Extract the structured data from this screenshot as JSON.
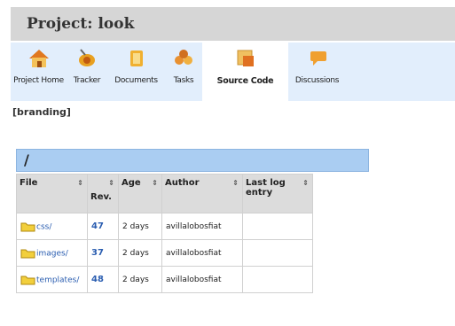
{
  "project": {
    "title": "Project: look"
  },
  "tabs": [
    {
      "label": "Project Home",
      "icon": "house-icon",
      "active": false
    },
    {
      "label": "Tracker",
      "icon": "bug-icon",
      "active": false
    },
    {
      "label": "Documents",
      "icon": "documents-icon",
      "active": false
    },
    {
      "label": "Tasks",
      "icon": "tasks-icon",
      "active": false
    },
    {
      "label": "Source Code",
      "icon": "source-code-icon",
      "active": true
    },
    {
      "label": "Discussions",
      "icon": "discussions-icon",
      "active": false
    }
  ],
  "branding": "[branding]",
  "directory": {
    "path": "/"
  },
  "table": {
    "headers": {
      "file": "File",
      "rev": "Rev.",
      "age": "Age",
      "author": "Author",
      "last_log": "Last log entry",
      "sort_icon": "⇕"
    },
    "rows": [
      {
        "file": "css/",
        "rev": "47",
        "age": "2 days",
        "author": "avillalobosfiat",
        "last_log": ""
      },
      {
        "file": "images/",
        "rev": "37",
        "age": "2 days",
        "author": "avillalobosfiat",
        "last_log": ""
      },
      {
        "file": "templates/",
        "rev": "48",
        "age": "2 days",
        "author": "avillalobosfiat",
        "last_log": ""
      }
    ]
  },
  "colors": {
    "tab_bar": "#e2eefc",
    "header": "#d6d6d6",
    "dir_bar": "#aacdf2",
    "link": "#2a5db0"
  }
}
